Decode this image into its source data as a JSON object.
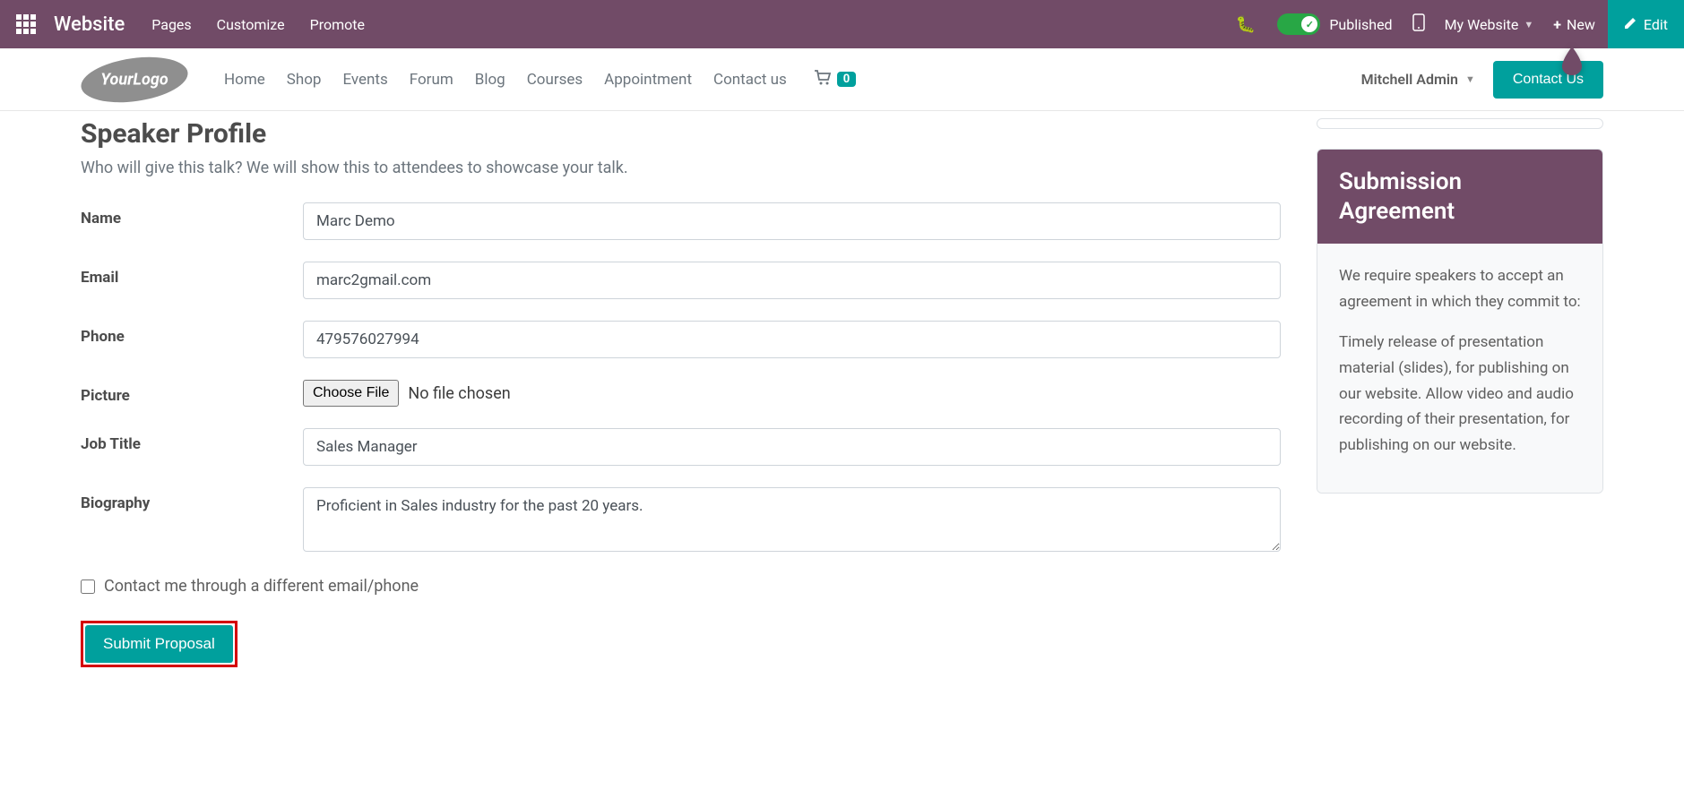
{
  "topbar": {
    "appTitle": "Website",
    "menu": [
      "Pages",
      "Customize",
      "Promote"
    ],
    "published": "Published",
    "myWebsite": "My Website",
    "new": "New",
    "edit": "Edit"
  },
  "header": {
    "logoText": "YourLogo",
    "nav": [
      "Home",
      "Shop",
      "Events",
      "Forum",
      "Blog",
      "Courses",
      "Appointment",
      "Contact us"
    ],
    "cartCount": "0",
    "userName": "Mitchell Admin",
    "contactBtn": "Contact Us"
  },
  "main": {
    "title": "Speaker Profile",
    "subtitle": "Who will give this talk? We will show this to attendees to showcase your talk.",
    "labels": {
      "name": "Name",
      "email": "Email",
      "phone": "Phone",
      "picture": "Picture",
      "jobTitle": "Job Title",
      "biography": "Biography"
    },
    "values": {
      "name": "Marc Demo",
      "email": "marc2gmail.com",
      "phone": "479576027994",
      "jobTitle": "Sales Manager",
      "biography": "Proficient in Sales industry for the past 20 years."
    },
    "file": {
      "button": "Choose File",
      "status": "No file chosen"
    },
    "altContactLabel": "Contact me through a different email/phone",
    "submit": "Submit Proposal"
  },
  "sidebar": {
    "cardTitle": "Submission Agreement",
    "p1": "We require speakers to accept an agreement in which they commit to:",
    "p2": "Timely release of presentation material (slides), for publishing on our website. Allow video and audio recording of their presentation, for publishing on our website."
  }
}
